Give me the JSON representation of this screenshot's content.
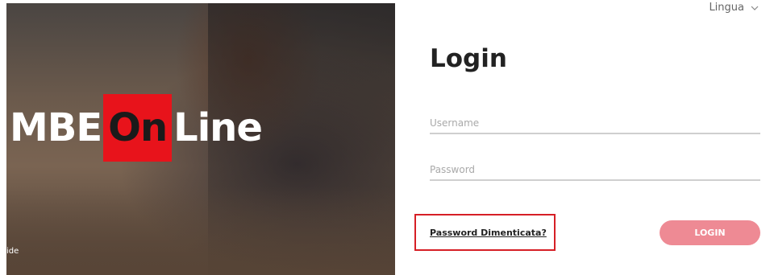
{
  "hero": {
    "logo_left": "MBE",
    "logo_highlight": "On",
    "logo_right": "Line",
    "caption": "ide"
  },
  "header": {
    "language_label": "Lingua",
    "language_icon": "chevron-down-icon"
  },
  "login": {
    "title": "Login",
    "username_placeholder": "Username",
    "password_placeholder": "Password",
    "forgot_password": "Password Dimenticata?",
    "submit_label": "LOGIN"
  },
  "colors": {
    "brand_red": "#e8131b",
    "button": "#ee8a94",
    "highlight_border": "#d61f26"
  }
}
